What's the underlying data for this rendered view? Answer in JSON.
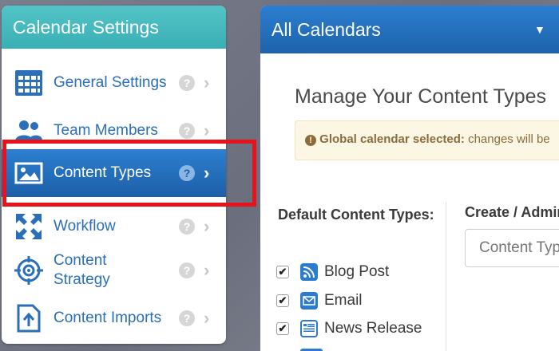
{
  "sidebar": {
    "title": "Calendar Settings",
    "items": [
      {
        "label": "General Settings",
        "icon": "grid-calendar-icon"
      },
      {
        "label": "Team Members",
        "icon": "users-icon"
      },
      {
        "label": "Content Types",
        "icon": "image-icon",
        "active": true
      },
      {
        "label": "Workflow",
        "icon": "workflow-arrows-icon"
      },
      {
        "label": "Content Strategy",
        "icon": "target-icon"
      },
      {
        "label": "Content Imports",
        "icon": "file-import-icon"
      }
    ],
    "help_glyph": "?",
    "chevron_glyph": "›"
  },
  "main": {
    "calendar_selector": "All Calendars",
    "caret": "▼",
    "title": "Manage Your Content Types",
    "alert": {
      "icon": "!",
      "bold": "Global calendar selected:",
      "text": " changes will be"
    },
    "default_types": {
      "heading": "Default Content Types:",
      "items": [
        {
          "label": "Blog Post",
          "checked": true,
          "icon": "rss-icon"
        },
        {
          "label": "Email",
          "checked": true,
          "icon": "envelope-icon"
        },
        {
          "label": "News Release",
          "checked": true,
          "icon": "newspaper-icon"
        }
      ],
      "check_glyph": "✔"
    },
    "create": {
      "heading": "Create / Admin",
      "placeholder": "Content Type"
    }
  },
  "colors": {
    "teal_header": "#46bbc0",
    "active_blue": "#2470c2",
    "link_blue": "#2a6fb8",
    "highlight_red": "#e8121a"
  }
}
